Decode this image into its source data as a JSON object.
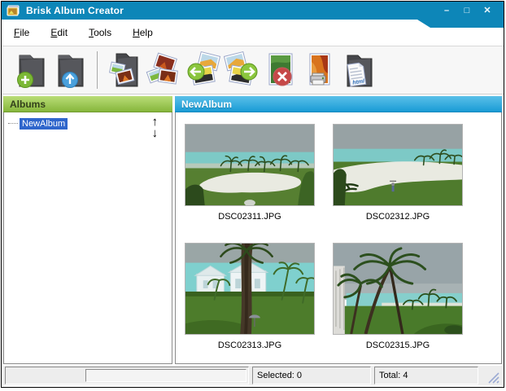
{
  "window": {
    "title": "Brisk Album Creator",
    "controls": {
      "minimize": "–",
      "maximize": "□",
      "close": "✕"
    }
  },
  "menu": {
    "items": [
      {
        "label": "File"
      },
      {
        "label": "Edit"
      },
      {
        "label": "Tools"
      },
      {
        "label": "Help"
      }
    ]
  },
  "toolbar": {
    "buttons": [
      {
        "name": "new-album",
        "icon": "folder-add-icon"
      },
      {
        "name": "album-up",
        "icon": "folder-up-arrow-icon"
      },
      {
        "name": "add-photos",
        "icon": "folder-photos-icon"
      },
      {
        "name": "photo-stack",
        "icon": "photo-stack-icon"
      },
      {
        "name": "move-photo-left",
        "icon": "photos-arrow-left-icon"
      },
      {
        "name": "move-photo-right",
        "icon": "photos-arrow-right-icon"
      },
      {
        "name": "delete-photo",
        "icon": "photo-delete-icon"
      },
      {
        "name": "print-photo",
        "icon": "photo-print-icon"
      },
      {
        "name": "export-html",
        "icon": "folder-html-icon",
        "badge": "html"
      }
    ]
  },
  "albums": {
    "header": "Albums",
    "tree": [
      {
        "label": "NewAlbum",
        "selected": true
      }
    ],
    "move_up_glyph": "↑",
    "move_down_glyph": "↓"
  },
  "album_view": {
    "header": "NewAlbum",
    "thumbnails": [
      {
        "filename": "DSC02311.JPG"
      },
      {
        "filename": "DSC02312.JPG"
      },
      {
        "filename": "DSC02313.JPG"
      },
      {
        "filename": "DSC02315.JPG"
      }
    ]
  },
  "statusbar": {
    "selected": "Selected: 0",
    "total": "Total: 4"
  },
  "colors": {
    "titlebar": "#0d86b8",
    "albums_header_top": "#badd78",
    "albums_header_bottom": "#86b63c",
    "album_header_top": "#5ac0e9",
    "album_header_bottom": "#1a9bd5",
    "tree_selection": "#2f66cc"
  }
}
